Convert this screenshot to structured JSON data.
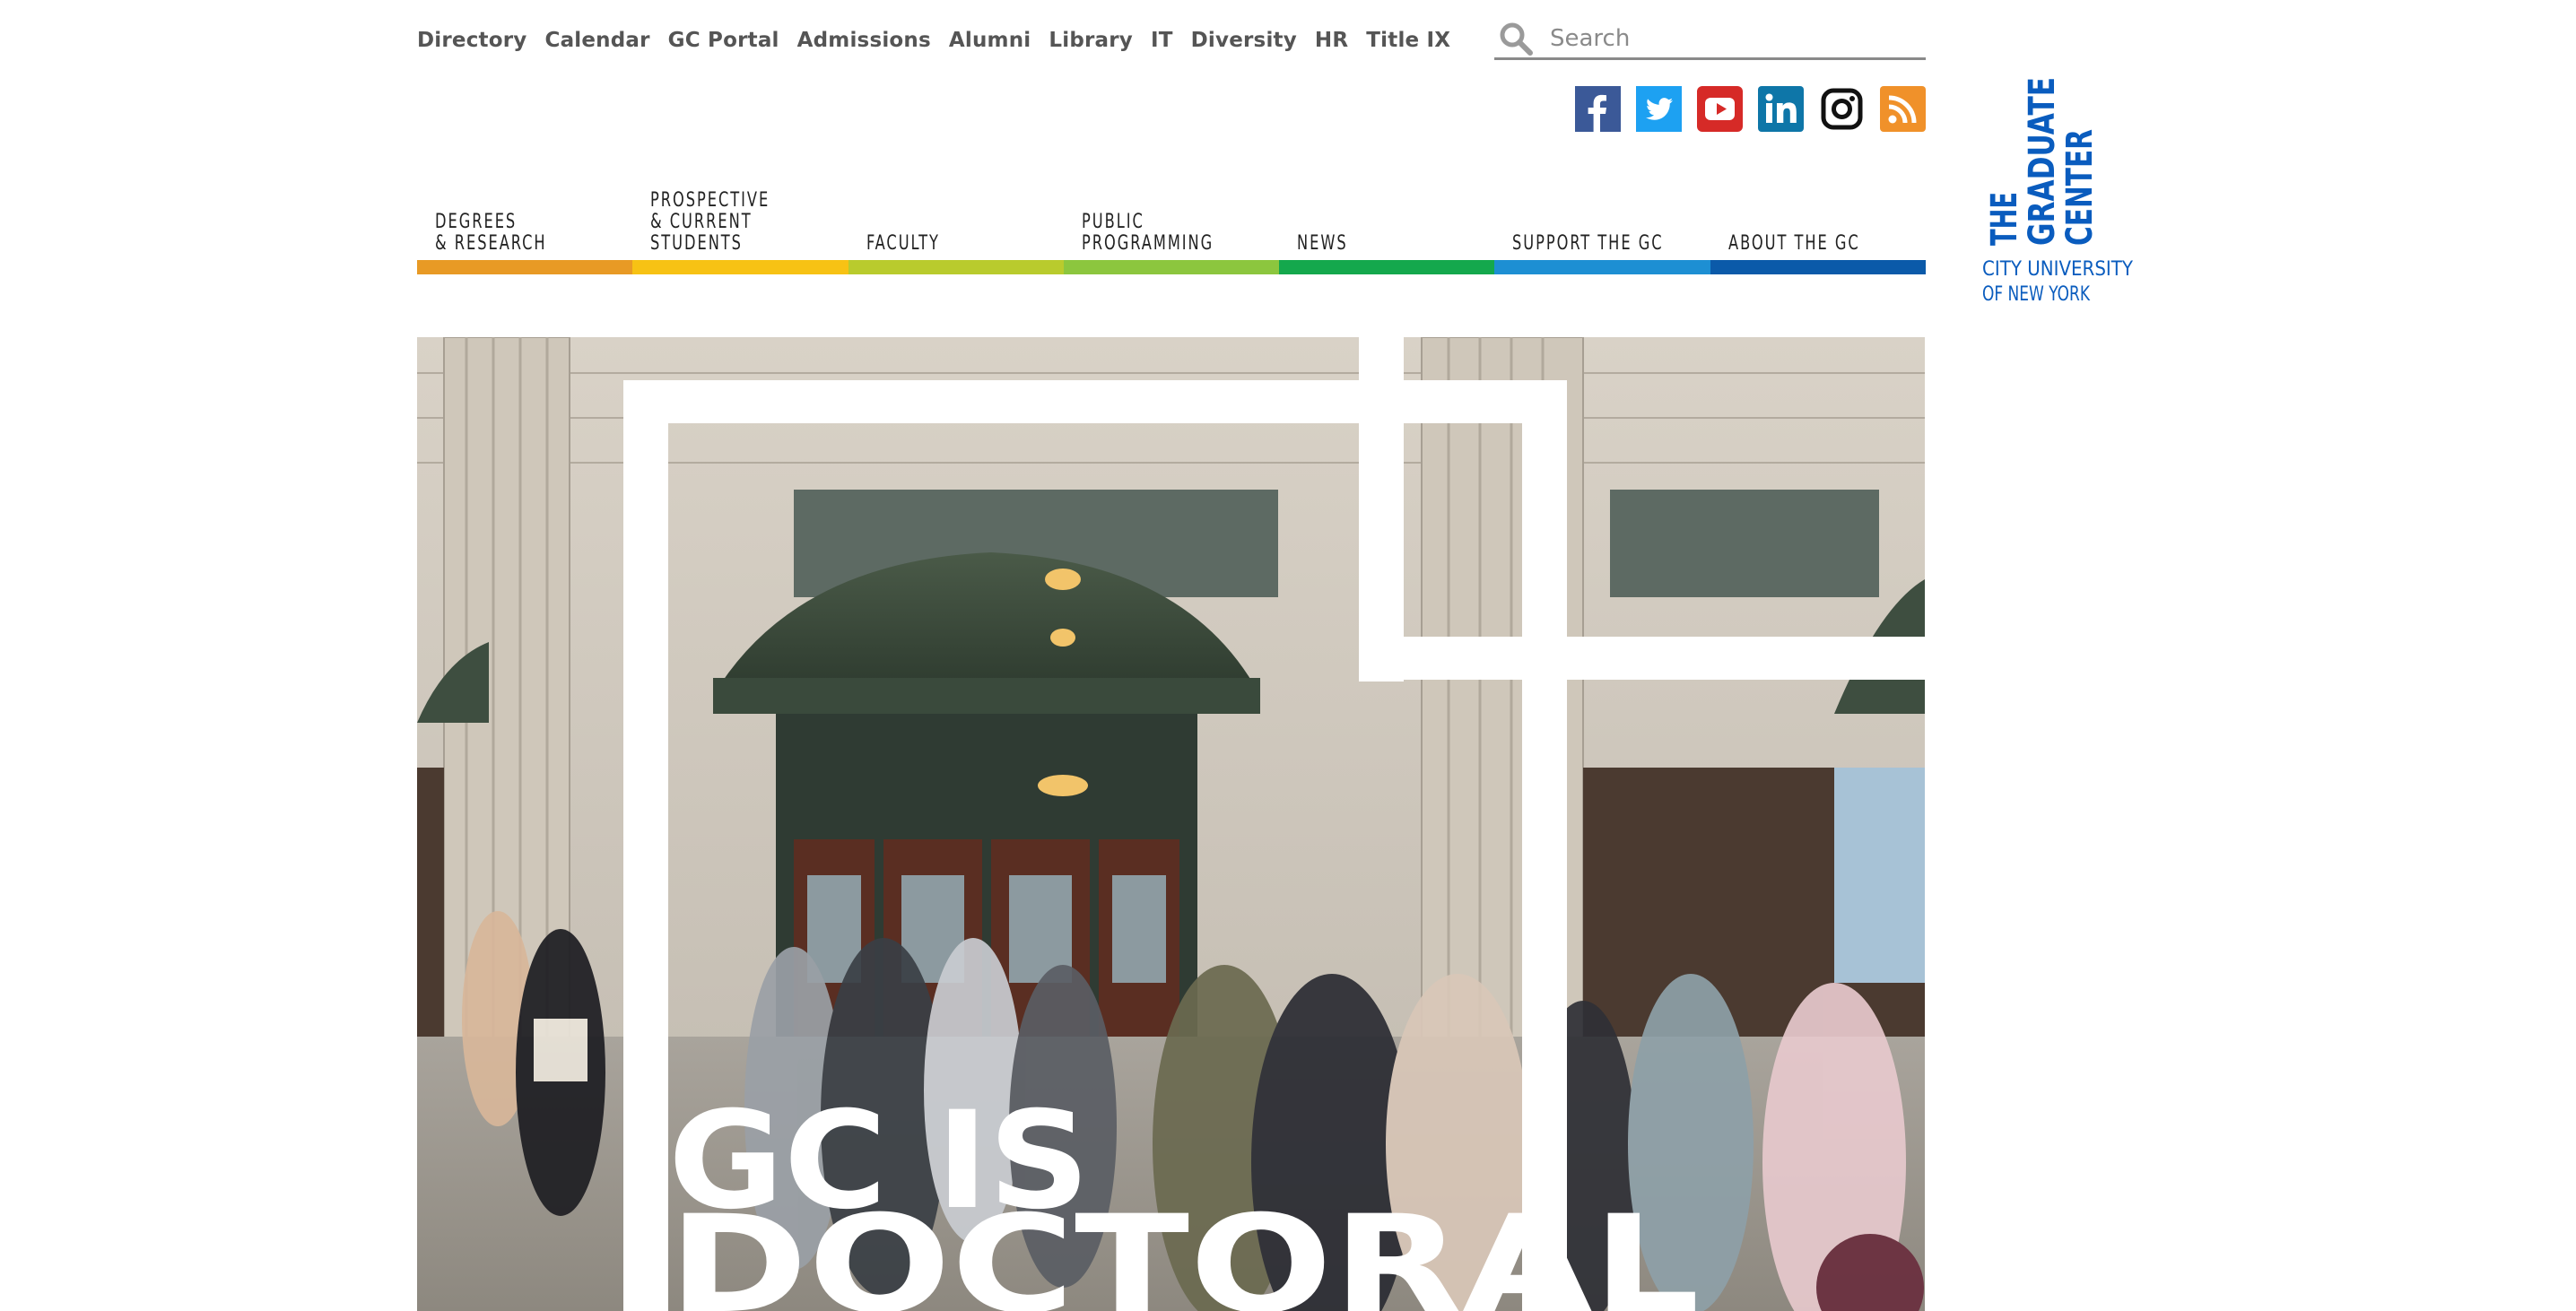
{
  "utility_nav": [
    {
      "label": "Directory"
    },
    {
      "label": "Calendar"
    },
    {
      "label": "GC Portal"
    },
    {
      "label": "Admissions"
    },
    {
      "label": "Alumni"
    },
    {
      "label": "Library"
    },
    {
      "label": "IT"
    },
    {
      "label": "Diversity"
    },
    {
      "label": "HR"
    },
    {
      "label": "Title IX"
    }
  ],
  "search": {
    "placeholder": "Search",
    "icon": "search-icon"
  },
  "social": [
    {
      "name": "facebook-icon",
      "color": "#3b5998"
    },
    {
      "name": "twitter-icon",
      "color": "#1da1f2"
    },
    {
      "name": "youtube-icon",
      "color": "#d62a27"
    },
    {
      "name": "linkedin-icon",
      "color": "#0e76a8"
    },
    {
      "name": "instagram-icon",
      "color": "#111111"
    },
    {
      "name": "rss-icon",
      "color": "#f0912a"
    }
  ],
  "logo": {
    "line1": "THE",
    "line2": "GRADUATE",
    "line3": "CENTER",
    "line4": "CITY UNIVERSITY",
    "line5": "OF NEW YORK",
    "color": "#0a5cbe"
  },
  "main_nav": [
    {
      "label": "DEGREES\n& RESEARCH",
      "color": "#e89a25"
    },
    {
      "label": "PROSPECTIVE\n& CURRENT\nSTUDENTS",
      "color": "#f7c214"
    },
    {
      "label": "FACULTY",
      "color": "#b9cb2d"
    },
    {
      "label": "PUBLIC\nPROGRAMMING",
      "color": "#8cc63e"
    },
    {
      "label": "NEWS",
      "color": "#14a84d"
    },
    {
      "label": "SUPPORT THE GC",
      "color": "#1d8fd3"
    },
    {
      "label": "ABOUT THE GC",
      "color": "#0b5aa9"
    }
  ],
  "hero": {
    "headline_line1": "GC IS",
    "headline_line2": "DOCTORAL"
  }
}
